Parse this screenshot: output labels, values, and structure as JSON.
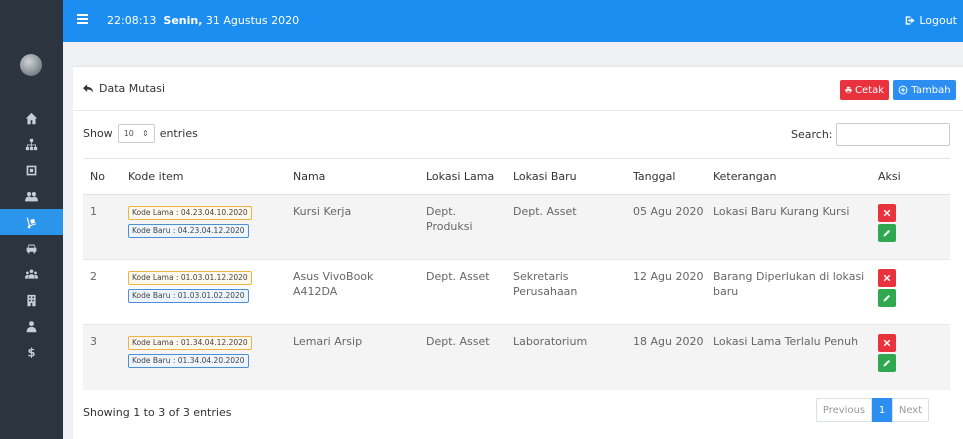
{
  "topbar": {
    "time": "22:08:13",
    "day": "Senin,",
    "date": "31 Agustus 2020",
    "logout_label": "Logout"
  },
  "sidebar": {
    "items": [
      {
        "icon": "home-icon"
      },
      {
        "icon": "sitemap-icon"
      },
      {
        "icon": "cube-icon"
      },
      {
        "icon": "users-cog-icon"
      },
      {
        "icon": "dolly-icon",
        "active": true
      },
      {
        "icon": "car-icon"
      },
      {
        "icon": "group-icon"
      },
      {
        "icon": "building-icon"
      },
      {
        "icon": "user-tie-icon"
      },
      {
        "icon": "dollar-icon"
      }
    ]
  },
  "card": {
    "title": "Data Mutasi",
    "print_label": "Cetak",
    "add_label": "Tambah"
  },
  "controls": {
    "show_label": "Show",
    "entries_value": "10",
    "entries_label": "entries",
    "search_label": "Search:",
    "search_value": ""
  },
  "table": {
    "headers": [
      "No",
      "Kode item",
      "Nama",
      "Lokasi Lama",
      "Lokasi Baru",
      "Tanggal",
      "Keterangan",
      "Aksi"
    ],
    "rows": [
      {
        "no": "1",
        "kode_lama": "Kode Lama : 04.23.04.10.2020",
        "kode_baru": "Kode Baru : 04.23.04.12.2020",
        "nama": "Kursi Kerja",
        "lokasi_lama": "Dept. Produksi",
        "lokasi_baru": "Dept. Asset",
        "tanggal": "05 Agu 2020",
        "keterangan": "Lokasi Baru Kurang Kursi"
      },
      {
        "no": "2",
        "kode_lama": "Kode Lama : 01.03.01.12.2020",
        "kode_baru": "Kode Baru : 01.03.01.02.2020",
        "nama": "Asus VivoBook A412DA",
        "lokasi_lama": "Dept. Asset",
        "lokasi_baru": "Sekretaris Perusahaan",
        "tanggal": "12 Agu 2020",
        "keterangan": "Barang Diperlukan di lokasi baru"
      },
      {
        "no": "3",
        "kode_lama": "Kode Lama : 01.34.04.12.2020",
        "kode_baru": "Kode Baru : 01.34.04.20.2020",
        "nama": "Lemari Arsip",
        "lokasi_lama": "Dept. Asset",
        "lokasi_baru": "Laboratorium",
        "tanggal": "18 Agu 2020",
        "keterangan": "Lokasi Lama Terlalu Penuh"
      }
    ]
  },
  "footer": {
    "info": "Showing 1 to 3 of 3 entries",
    "prev_label": "Previous",
    "page": "1",
    "next_label": "Next"
  },
  "colors": {
    "topbar": "#1c8ef1",
    "sidebar": "#2c3440",
    "danger": "#e8323d",
    "success": "#2fa84f",
    "primary": "#2b8ef0"
  }
}
